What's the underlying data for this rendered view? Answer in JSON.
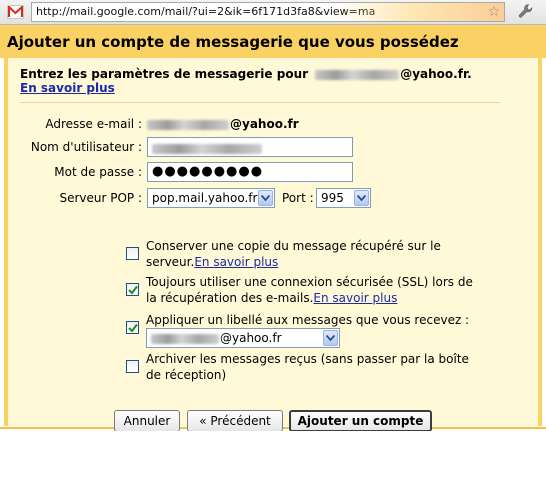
{
  "browser": {
    "url": "http://mail.google.com/mail/?ui=2&ik=6f171d3fa8&view=ma",
    "favicon_icon": "gmail-icon",
    "star_icon": "bookmark-star-icon",
    "menu_icon": "wrench-icon"
  },
  "dialog": {
    "title": "Ajouter un compte de messagerie que vous possédez",
    "intro": "Entrez les paramètres de messagerie pour",
    "intro_domain": "@yahoo.fr.",
    "learn_more": "En savoir plus"
  },
  "form": {
    "email_label": "Adresse e-mail :",
    "email_domain": "@yahoo.fr",
    "username_label": "Nom d'utilisateur :",
    "password_label": "Mot de passe :",
    "password_value": "●●●●●●●●●",
    "pop_label": "Serveur POP :",
    "pop_value": "pop.mail.yahoo.fr",
    "port_label": "Port :",
    "port_value": "995"
  },
  "options": {
    "keep_copy": {
      "text": "Conserver une copie du message récupéré sur le serveur.",
      "link": "En savoir plus",
      "checked": false
    },
    "ssl": {
      "text": "Toujours utiliser une connexion sécurisée (SSL) lors de la récupération des e-mails.",
      "link": "En savoir plus",
      "checked": true
    },
    "label": {
      "text": "Appliquer un libellé aux messages que vous recevez :",
      "select_value": "@yahoo.fr",
      "checked": true
    },
    "archive": {
      "text": "Archiver les messages reçus (sans passer par la boîte de réception)",
      "checked": false
    }
  },
  "buttons": {
    "cancel": "Annuler",
    "previous": "« Précédent",
    "add": "Ajouter un compte"
  },
  "colors": {
    "title_bar": "#fad163",
    "panel_bg": "#fff9d7",
    "link": "#1a2aa8"
  }
}
